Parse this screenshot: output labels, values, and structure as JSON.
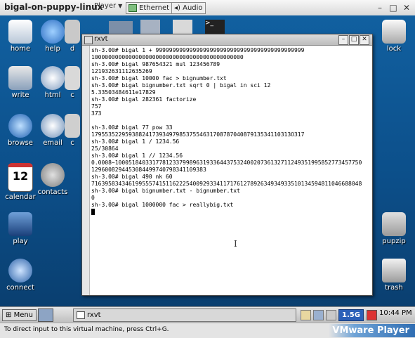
{
  "vm": {
    "title": "bigal-on-puppy-linux",
    "player_menu": "Player",
    "ethernet": "Ethernet",
    "audio": "Audio",
    "status_msg": "To direct input to this virtual machine, press Ctrl+G.",
    "brand": "VMware Player"
  },
  "desktop_icons": [
    {
      "label": "home",
      "icon": "home-icon"
    },
    {
      "label": "help",
      "icon": "help-icon"
    },
    {
      "label": "d",
      "icon": "drive-icon"
    },
    {
      "label": "write",
      "icon": "write-icon"
    },
    {
      "label": "html",
      "icon": "html-icon"
    },
    {
      "label": "c",
      "icon": "calc-icon"
    },
    {
      "label": "browse",
      "icon": "browse-icon"
    },
    {
      "label": "email",
      "icon": "email-icon"
    },
    {
      "label": "c",
      "icon": "chat-icon"
    },
    {
      "label": "calendar",
      "icon": "calendar-icon"
    },
    {
      "label": "contacts",
      "icon": "contacts-icon"
    },
    {
      "label": "play",
      "icon": "play-icon"
    },
    {
      "label": "connect",
      "icon": "connect-icon"
    },
    {
      "label": "lock",
      "icon": "lock-icon"
    },
    {
      "label": "pupzip",
      "icon": "pupzip-icon"
    },
    {
      "label": "trash",
      "icon": "trash-icon"
    }
  ],
  "terminal": {
    "title": "rxvt",
    "lines": [
      "sh-3.00# bigal 1 + 99999999999999999999999999999999999999999999",
      "100000000000000000000000000000000000000000000",
      "sh-3.00# bigal 987654321 mul 123456789",
      "121932631112635269",
      "sh-3.00# bigal 10000 fac > bignumber.txt",
      "sh-3.00# bigal bignumber.txt sqrt 0 | bigal in sci 12",
      "5.33503484611e17829",
      "sh-3.00# bigal 282361 factorize",
      "757",
      "373",
      "",
      "sh-3.00# bigal 77 pow 33",
      "17955352295938824173934979853755463170878704087913534110313O317",
      "sh-3.00# bigal 1 / 1234.56",
      "25/30864",
      "sh-3.00# bigal 1 // 1234.56",
      "0.0008~1000518403317781233799896319336443753240020736132711249351995852773457750",
      "1296008294453084499740798341109383",
      "sh-3.00# bigal 490 nk 60",
      "71639583434619955574151162225400929334117176127892634934933510134594811046688048",
      "sh-3.00# bigal bignumber.txt - bignumber.txt",
      "0",
      "sh-3.00# bigal 1000000 fac > reallybig.txt"
    ],
    "cursor_char": " "
  },
  "taskbar": {
    "start": "Menu",
    "task": "rxvt",
    "mem": "1.5G",
    "clock": "10:44 PM"
  }
}
